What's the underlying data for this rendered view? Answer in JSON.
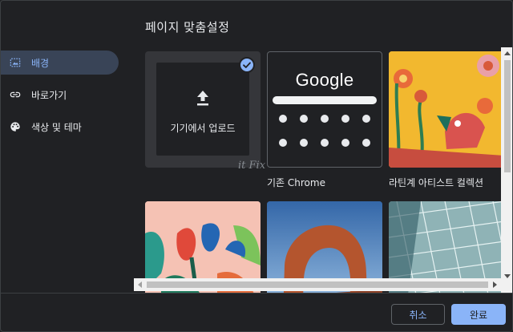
{
  "dialog": {
    "title": "페이지 맞춤설정"
  },
  "sidebar": {
    "items": [
      {
        "label": "배경",
        "icon": "background-icon",
        "active": true
      },
      {
        "label": "바로가기",
        "icon": "link-icon",
        "active": false
      },
      {
        "label": "색상 및 테마",
        "icon": "palette-icon",
        "active": false
      }
    ]
  },
  "tiles": {
    "upload": {
      "label": "기기에서 업로드",
      "selected": true
    },
    "chrome": {
      "logo_text": "Google",
      "caption": "기존 Chrome"
    },
    "latinx": {
      "caption": "라틴계 아티스트 컬렉션"
    }
  },
  "watermark": "it Fix",
  "footer": {
    "cancel_label": "취소",
    "done_label": "완료"
  },
  "colors": {
    "accent": "#8ab4f8",
    "background": "#202124",
    "active_nav_bg": "#394457"
  }
}
